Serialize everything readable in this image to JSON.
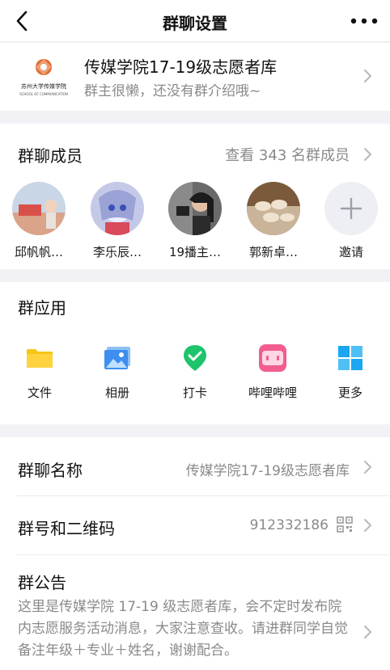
{
  "navbar": {
    "title": "群聊设置"
  },
  "group": {
    "name": "传媒学院17-19级志愿者库",
    "intro": "群主很懒，还没有群介绍哦~",
    "logo_text": "苏州大学传媒学院",
    "logo_subtext": "SCHOOL OF COMMUNICATION"
  },
  "members": {
    "title": "群聊成员",
    "view_all": "查看 343 名群成员",
    "list": [
      {
        "name": "邱帆帆…"
      },
      {
        "name": "李乐辰…"
      },
      {
        "name": "19播主…"
      },
      {
        "name": "郭新卓…"
      }
    ],
    "invite_label": "邀请"
  },
  "apps": {
    "title": "群应用",
    "items": [
      {
        "label": "文件",
        "icon": "folder-icon",
        "color": "#f5c518"
      },
      {
        "label": "相册",
        "icon": "photo-album-icon",
        "color": "#3d8ef0"
      },
      {
        "label": "打卡",
        "icon": "check-in-icon",
        "color": "#1ec46b"
      },
      {
        "label": "哔哩哔哩",
        "icon": "bilibili-icon",
        "color": "#f25d8e"
      },
      {
        "label": "更多",
        "icon": "grid-more-icon",
        "color": "#1aa6f0"
      }
    ]
  },
  "settings": {
    "group_name_label": "群聊名称",
    "group_name_value": "传媒学院17-19级志愿者库",
    "group_id_label": "群号和二维码",
    "group_id_value": "912332186",
    "notice_label": "群公告",
    "notice_text": "这里是传媒学院 17-19 级志愿者库，会不定时发布院内志愿服务活动消息，大家注意查收。请进群同学自觉备注年级＋专业＋姓名，谢谢配合。"
  }
}
